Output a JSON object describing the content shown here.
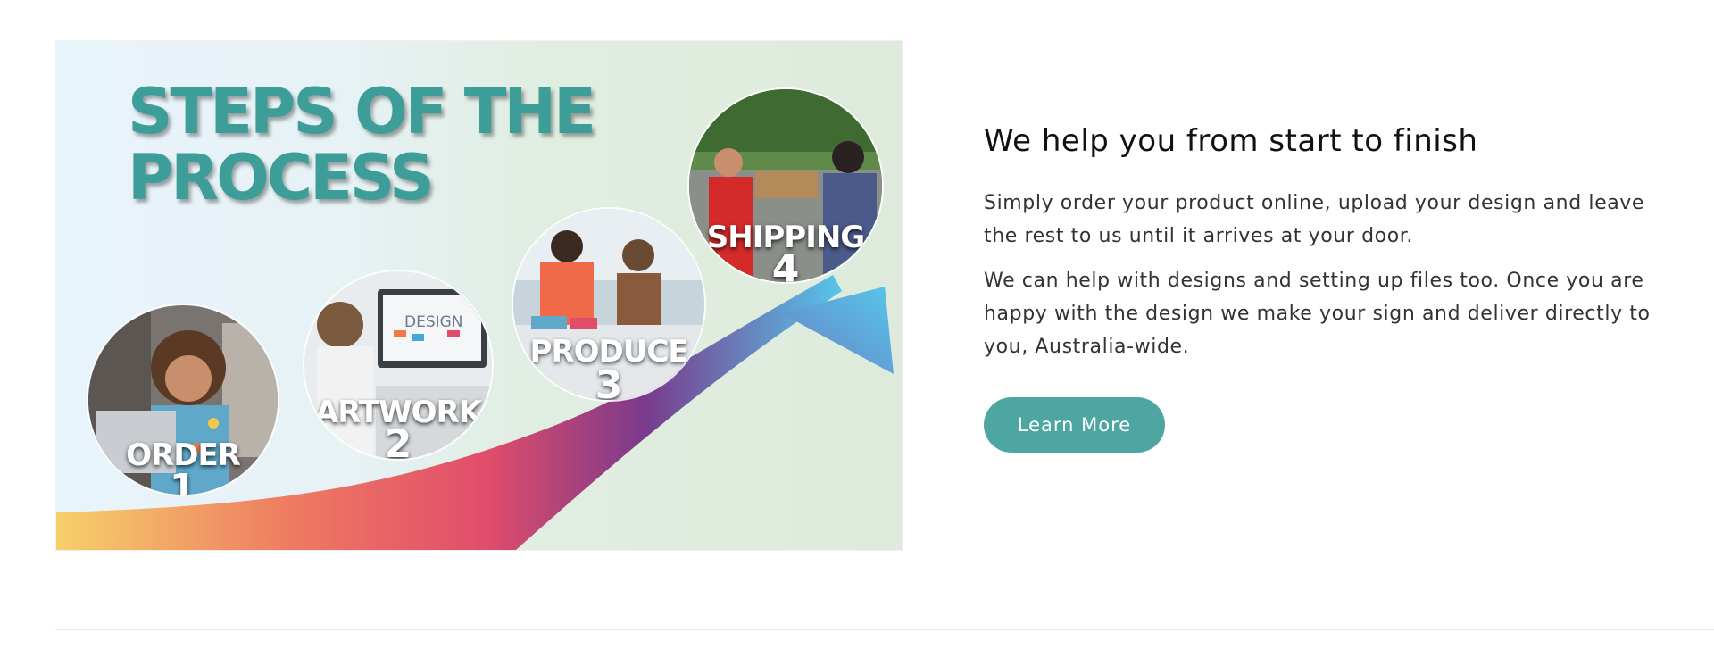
{
  "banner": {
    "title_line1": "STEPS OF THE",
    "title_line2": "PROCESS",
    "steps": [
      {
        "label": "ORDER",
        "number": "1"
      },
      {
        "label": "ARTWORK",
        "number": "2"
      },
      {
        "label": "PRODUCE",
        "number": "3"
      },
      {
        "label": "SHIPPING",
        "number": "4"
      }
    ],
    "monitor_text": "DESIGN",
    "colors": {
      "title": "#3d9d98",
      "curve_start": "#f6d06a",
      "curve_mid": "#e14c6a",
      "curve_purple": "#7a3a8c",
      "curve_end": "#56c6ea"
    }
  },
  "section": {
    "heading": "We help you from start to finish",
    "paragraph1": "Simply order your product online, upload your design and leave the rest to us until it arrives at your door.",
    "paragraph2": "We can help with designs and setting up files too. Once you are happy with the design we make your sign and deliver directly to you, Australia-wide.",
    "button_label": "Learn More",
    "button_color": "#4ea6a3"
  }
}
